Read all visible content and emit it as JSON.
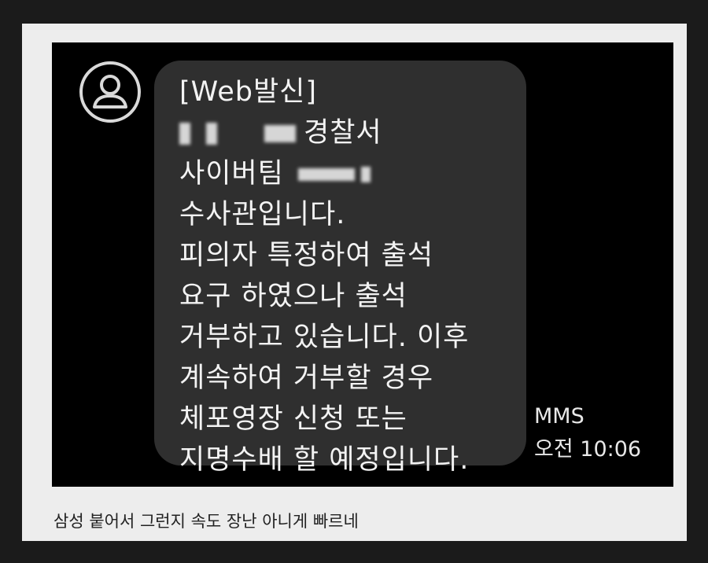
{
  "message": {
    "lines": [
      "[Web발신]",
      "경찰서",
      "사이버팀",
      "수사관입니다.",
      "피의자 특정하여 출석",
      "요구 하였으나 출석",
      "거부하고 있습니다. 이후",
      "계속하여 거부할 경우",
      "체포영장 신청 또는",
      "지명수배 할 예정입니다."
    ],
    "type": "MMS",
    "time": "오전 10:06"
  },
  "avatar": {
    "icon": "person-icon"
  },
  "caption": "삼성 붙어서 그런지 속도 장난 아니게 빠르네",
  "colors": {
    "page_bg": "#1b1b1b",
    "card_bg": "#ededed",
    "screenshot_bg": "#000000",
    "bubble_bg": "#2f2f2f",
    "text": "#f3f3f3"
  }
}
